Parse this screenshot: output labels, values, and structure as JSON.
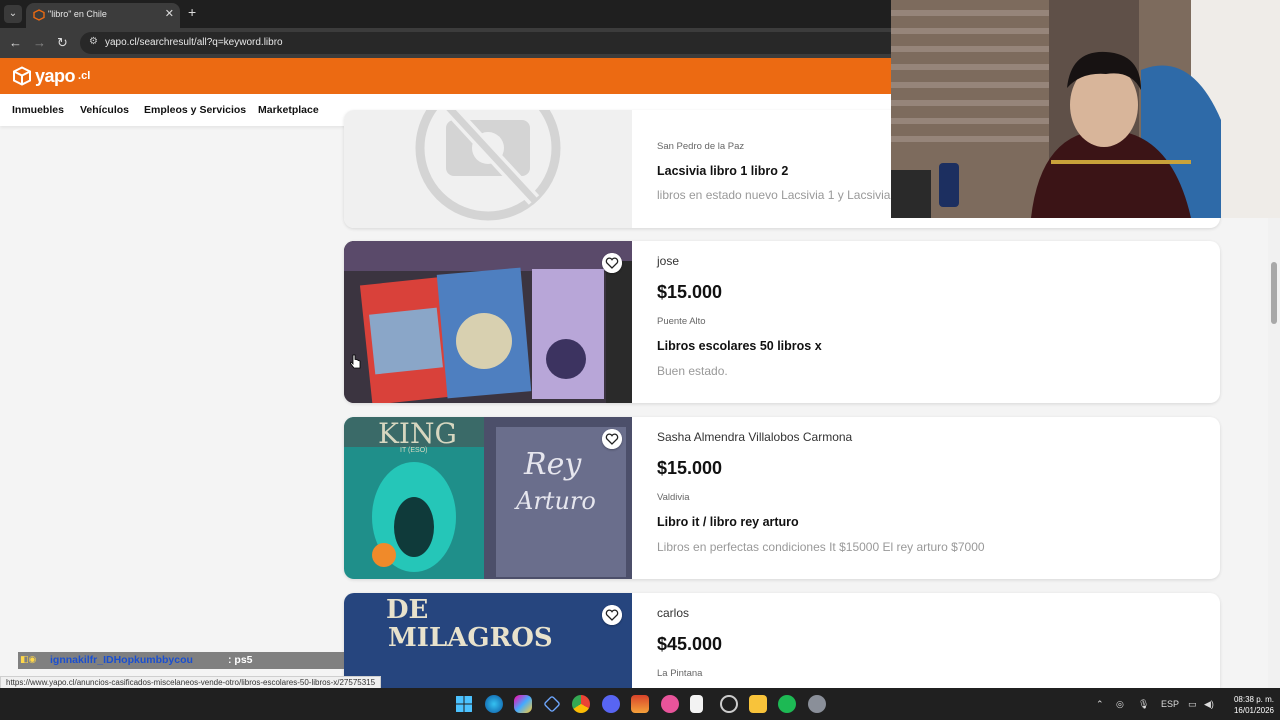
{
  "browser": {
    "tab_title": "\"libro\" en Chile",
    "tab_close": "✕",
    "new_tab": "+",
    "url": "yapo.cl/searchresult/all?q=keyword.libro",
    "back": "←",
    "forward": "→",
    "reload": "↻",
    "site_info": "⚙"
  },
  "header": {
    "logo_word": "yapo",
    "logo_suffix": ".cl",
    "brand_color": "#ec6a12"
  },
  "nav": {
    "items": [
      "Inmuebles",
      "Vehículos",
      "Empleos y Servicios",
      "Marketplace"
    ]
  },
  "listings": [
    {
      "seller": "",
      "price": "",
      "location": "San Pedro de la Paz",
      "title": "Lacsivia libro 1 libro 2",
      "description": "libros en estado nuevo Lacsivia 1 y Lacsivia"
    },
    {
      "seller": "jose",
      "price": "$15.000",
      "location": "Puente Alto",
      "title": "Libros escolares 50 libros x",
      "description": "Buen estado."
    },
    {
      "seller": "Sasha Almendra Villalobos Carmona",
      "price": "$15.000",
      "location": "Valdivia",
      "title": "Libro it / libro rey arturo",
      "description": "Libros en perfectas condiciones It $15000 El rey arturo $7000"
    },
    {
      "seller": "carlos",
      "price": "$45.000",
      "location": "La Pintana",
      "title": "",
      "description": ""
    }
  ],
  "thumb_texts": {
    "king": "KING",
    "it": "IT (ESO)",
    "rey": "Rey",
    "arturo": "Arturo",
    "de": "DE",
    "milagros": "MILAGROS"
  },
  "overlay": {
    "chat_user": "ignnakilfr_IDHopkumbbycou",
    "chat_message": ": ps5",
    "status_url": "https://www.yapo.cl/anuncios-casificados-miscelaneos-vende-otro/libros-escolares-50-libros-x/27575315"
  },
  "taskbar": {
    "language": "ESP",
    "time": "08:38 p. m.",
    "date": "16/01/2026"
  }
}
